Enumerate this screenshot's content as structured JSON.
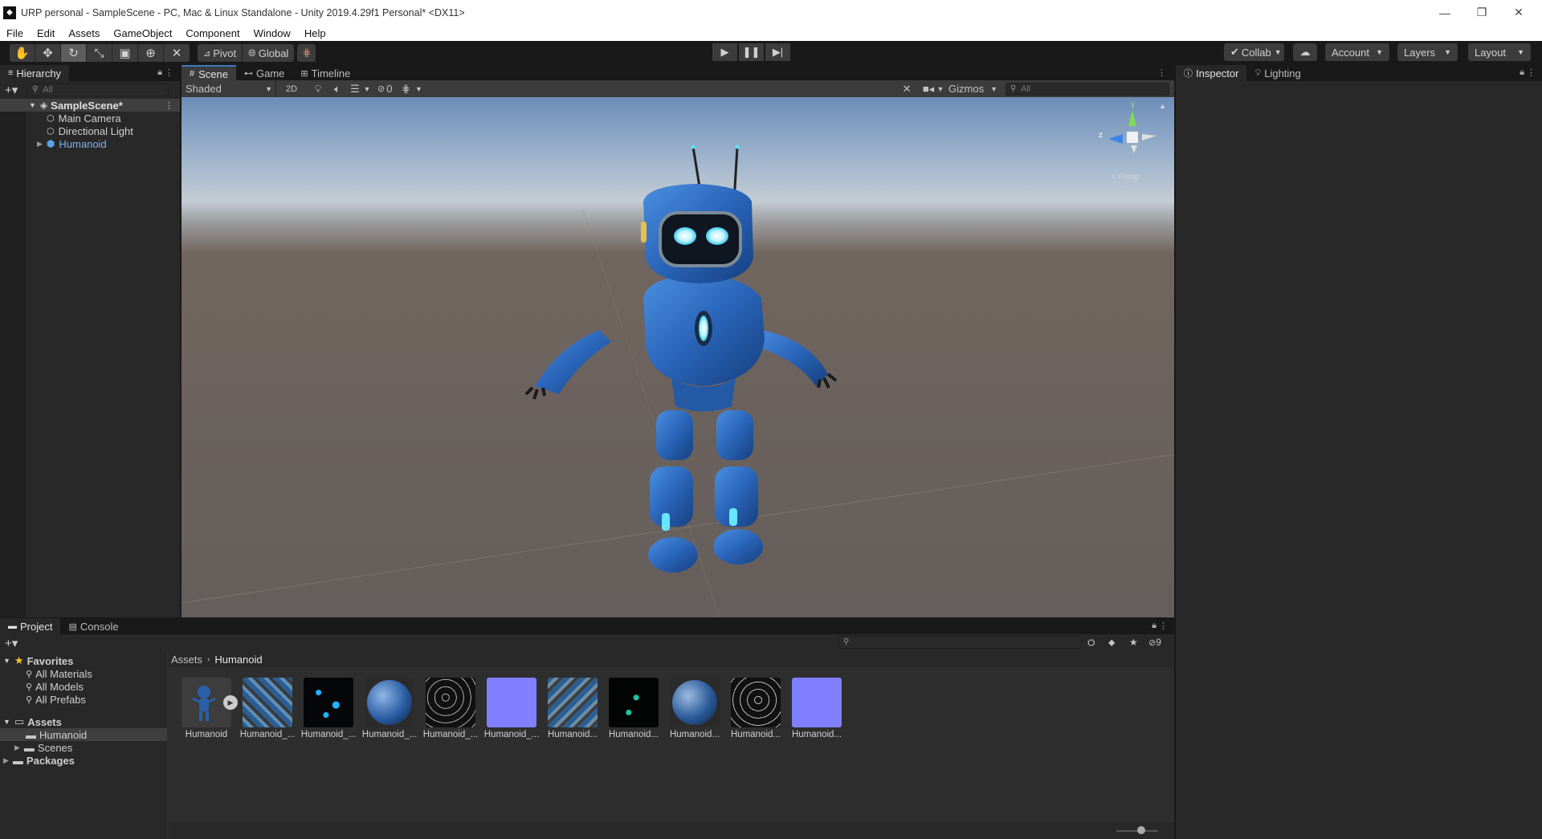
{
  "window": {
    "title": "URP personal - SampleScene - PC, Mac & Linux Standalone - Unity 2019.4.29f1 Personal* <DX11>",
    "minimize": "—",
    "restore": "❐",
    "close": "✕"
  },
  "menu": [
    "File",
    "Edit",
    "Assets",
    "GameObject",
    "Component",
    "Window",
    "Help"
  ],
  "toolbar": {
    "pivot": "Pivot",
    "global": "Global",
    "collab": "Collab",
    "account": "Account",
    "layers": "Layers",
    "layout": "Layout"
  },
  "hierarchy": {
    "tab": "Hierarchy",
    "search_placeholder": "All",
    "scene": "SampleScene*",
    "items": [
      "Main Camera",
      "Directional Light",
      "Humanoid"
    ]
  },
  "scene_tabs": [
    "Scene",
    "Game",
    "Timeline"
  ],
  "scene_toolbar": {
    "shading": "Shaded",
    "mode_2d": "2D",
    "hidden_count": "0",
    "gizmos": "Gizmos",
    "search_placeholder": "All"
  },
  "gizmo": {
    "y": "y",
    "z": "z",
    "persp": "< Persp"
  },
  "inspector": {
    "tabs": [
      "Inspector",
      "Lighting"
    ]
  },
  "project": {
    "tabs": [
      "Project",
      "Console"
    ],
    "favorites": "Favorites",
    "favorite_items": [
      "All Materials",
      "All Models",
      "All Prefabs"
    ],
    "assets": "Assets",
    "asset_folders": [
      "Humanoid",
      "Scenes"
    ],
    "packages": "Packages",
    "breadcrumb": [
      "Assets",
      "Humanoid"
    ],
    "hidden_count": "9",
    "items": [
      {
        "label": "Humanoid",
        "icon": "model-icon"
      },
      {
        "label": "Humanoid_...",
        "icon": "texture-icon"
      },
      {
        "label": "Humanoid_...",
        "icon": "texture-icon"
      },
      {
        "label": "Humanoid_...",
        "icon": "material-icon"
      },
      {
        "label": "Humanoid_...",
        "icon": "texture-icon"
      },
      {
        "label": "Humanoid_...",
        "icon": "texture-icon"
      },
      {
        "label": "Humanoid...",
        "icon": "texture-icon"
      },
      {
        "label": "Humanoid...",
        "icon": "texture-icon"
      },
      {
        "label": "Humanoid...",
        "icon": "material-icon"
      },
      {
        "label": "Humanoid...",
        "icon": "texture-icon"
      },
      {
        "label": "Humanoid...",
        "icon": "texture-icon"
      }
    ]
  },
  "colors": {
    "accent": "#3a79bb",
    "panel": "#282828",
    "selection": "#2c5d87",
    "robot": "#2f6fc4"
  }
}
